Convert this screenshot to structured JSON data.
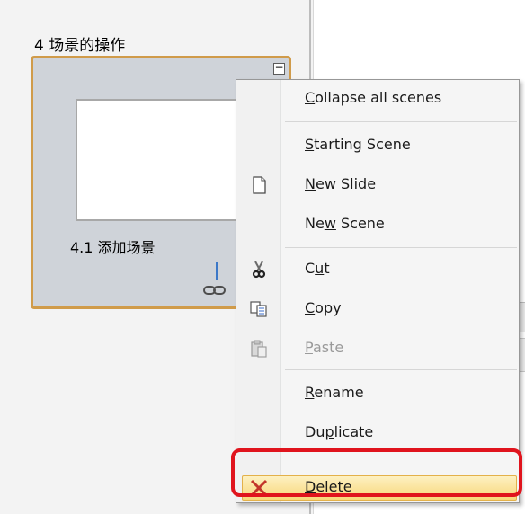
{
  "section": {
    "title": "4 场景的操作"
  },
  "scene": {
    "title": "4.1 添加场景"
  },
  "menu": {
    "items": [
      {
        "id": "collapse",
        "label_pre": "",
        "label_u": "C",
        "label_post": "ollapse all scenes",
        "icon": ""
      },
      {
        "id": "starting",
        "label_pre": "",
        "label_u": "S",
        "label_post": "tarting Scene",
        "icon": ""
      },
      {
        "id": "newslide",
        "label_pre": "",
        "label_u": "N",
        "label_post": "ew Slide",
        "icon": "new-slide-icon"
      },
      {
        "id": "newscene",
        "label_pre": "Ne",
        "label_u": "w",
        "label_post": " Scene",
        "icon": ""
      },
      {
        "id": "cut",
        "label_pre": "C",
        "label_u": "u",
        "label_post": "t",
        "icon": "scissors-icon"
      },
      {
        "id": "copy",
        "label_pre": "",
        "label_u": "C",
        "label_post": "opy",
        "icon": "copy-icon"
      },
      {
        "id": "paste",
        "label_pre": "",
        "label_u": "P",
        "label_post": "aste",
        "icon": "paste-icon"
      },
      {
        "id": "rename",
        "label_pre": "",
        "label_u": "R",
        "label_post": "ename",
        "icon": ""
      },
      {
        "id": "duplicate",
        "label_pre": "Du",
        "label_u": "p",
        "label_post": "licate",
        "icon": ""
      },
      {
        "id": "delete",
        "label_pre": "",
        "label_u": "D",
        "label_post": "elete",
        "icon": "delete-x-icon"
      }
    ]
  },
  "colors": {
    "highlight_border": "#e0141d",
    "scene_border": "#d09b4a",
    "menu_hover": "#f8d779"
  }
}
